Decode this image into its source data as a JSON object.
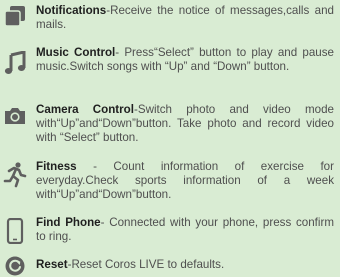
{
  "features": [
    {
      "icon": "notifications-icon",
      "title": "Notifications",
      "text": "-Receive the notice of messages,calls and mails."
    },
    {
      "icon": "music-note-icon",
      "title": "Music Control",
      "text": "- Press“Select” button to play and pause music.Switch songs with “Up” and “Down” button."
    },
    {
      "icon": "camera-icon",
      "title": "Camera Control",
      "text": "-Switch photo and video mode with“Up”and“Down”button. Take photo and record video with “Select” button."
    },
    {
      "icon": "running-person-icon",
      "title": "Fitness",
      "text": " - Count information of exercise for everyday.Check sports information of a week with“Up”and“Down”button."
    },
    {
      "icon": "phone-icon",
      "title": "Find Phone",
      "text": "- Connected with your phone, press confirm to ring."
    },
    {
      "icon": "reset-icon",
      "title": "Reset",
      "text": "-Reset Coros LIVE to defaults."
    }
  ],
  "colors": {
    "background": "#d9ecd3",
    "icon": "#5f5f5f",
    "title": "#1f1f1f",
    "text": "#4f4f4f"
  }
}
